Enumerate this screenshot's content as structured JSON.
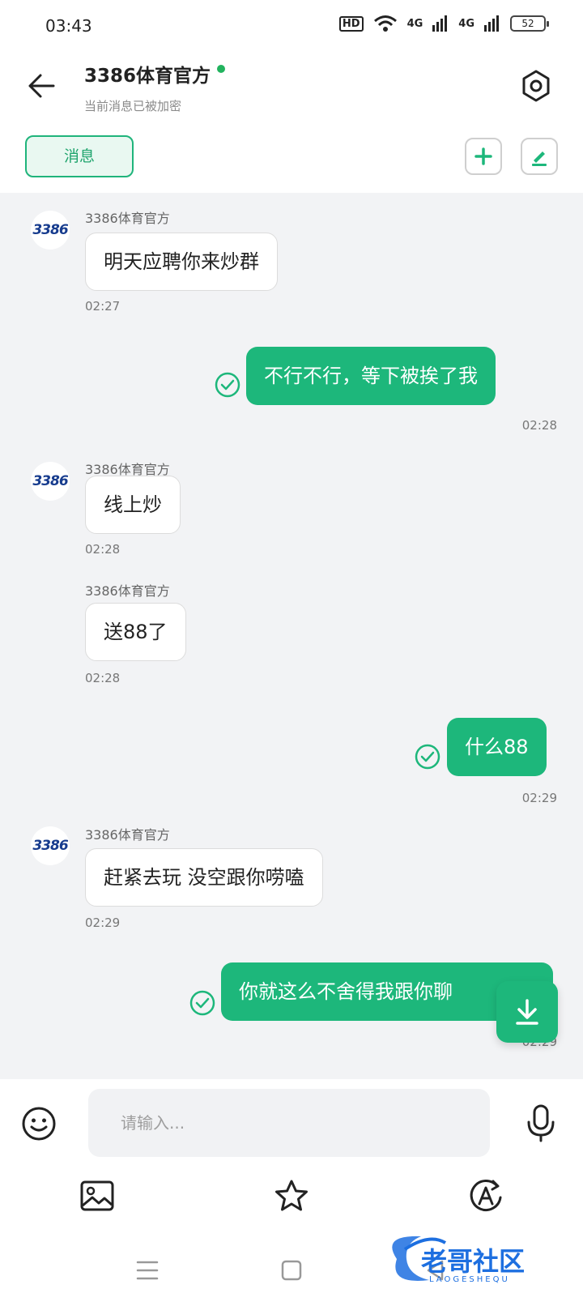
{
  "status_bar": {
    "time": "03:43",
    "hd_label": "HD",
    "signal1": "4G",
    "signal2": "4G",
    "battery": "52"
  },
  "header": {
    "title": "3386体育官方",
    "subtitle": "当前消息已被加密",
    "online_color": "#22b35e"
  },
  "toolbar": {
    "tab_label": "消息"
  },
  "avatar_text": "3386",
  "messages": [
    {
      "direction": "in",
      "sender": "3386体育官方",
      "text": "明天应聘你来炒群",
      "time": "02:27"
    },
    {
      "direction": "out",
      "text": "不行不行，等下被挨了我",
      "time": "02:28",
      "status": "sent-check"
    },
    {
      "direction": "in",
      "sender": "3386体育官方",
      "text": "线上炒",
      "time": "02:28"
    },
    {
      "direction": "in",
      "sender": "3386体育官方",
      "text": "送88了",
      "time": "02:28"
    },
    {
      "direction": "out",
      "text": "什么88",
      "time": "02:29",
      "status": "sent-check"
    },
    {
      "direction": "in",
      "sender": "3386体育官方",
      "text": "赶紧去玩 没空跟你唠嗑",
      "time": "02:29"
    },
    {
      "direction": "out",
      "text": "你就这么不舍得我跟你聊",
      "time": "02:29",
      "status": "sent-check"
    }
  ],
  "input": {
    "placeholder": "请输入..."
  },
  "icons": {
    "back": "arrow-left-icon",
    "settings": "hexagon-settings-icon",
    "add": "plus-icon",
    "edit": "pen-icon",
    "scroll": "download-arrow-icon",
    "emoji": "smiley-icon",
    "mic": "microphone-icon",
    "image": "image-icon",
    "favorite": "star-icon",
    "translate": "translate-icon"
  },
  "watermark": {
    "text": "老哥社区",
    "sub": "LAOGESHEQU"
  },
  "colors": {
    "accent": "#1db77b",
    "chat_bg": "#f2f3f5"
  }
}
